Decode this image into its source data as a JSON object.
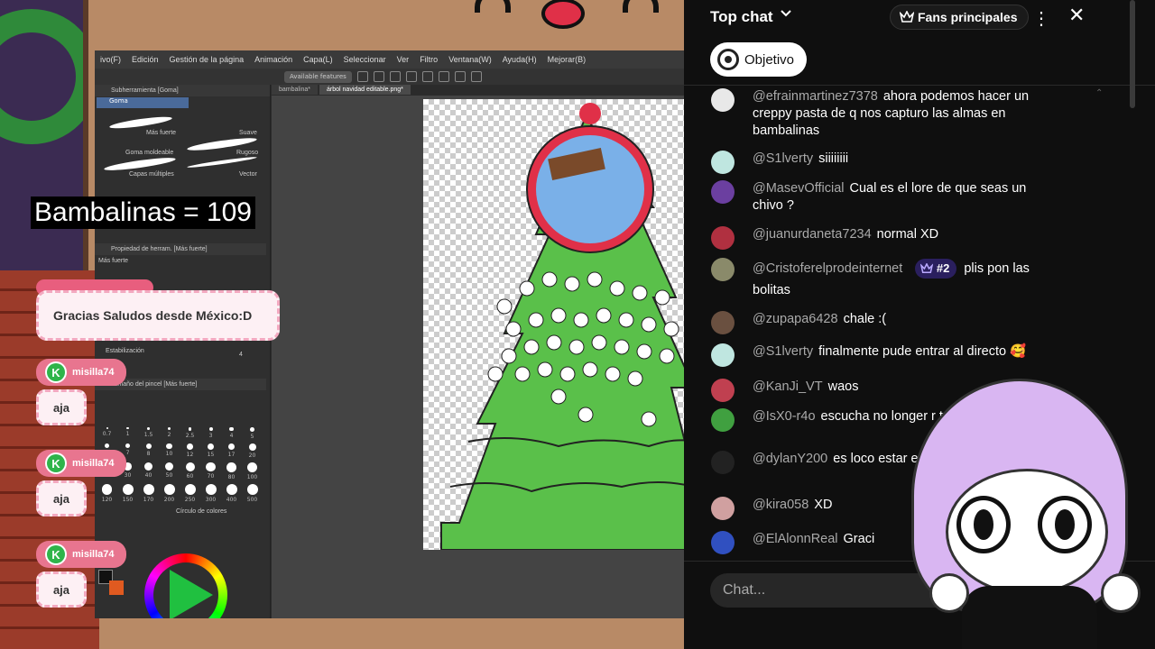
{
  "scene": {
    "counter": "Bambalinas = 109",
    "highlight_message": "Gracias Saludos desde México:D",
    "chat_messages": [
      {
        "user": "misilla74",
        "text": "aja"
      },
      {
        "user": "misilla74",
        "text": "aja"
      },
      {
        "user": "misilla74",
        "text": "aja"
      }
    ]
  },
  "csp": {
    "menu": [
      "ivo(F)",
      "Edición",
      "Gestión de la página",
      "Animación",
      "Capa(L)",
      "Seleccionar",
      "Ver",
      "Filtro",
      "Ventana(W)",
      "Ayuda(H)",
      "Mejorar(B)"
    ],
    "toolbar_pill": "Available features",
    "tabs": [
      "bambalina*",
      "árbol navidad editable.png*"
    ],
    "subtool_panel_title": "Subherramienta [Goma]",
    "subtool_selected": "Goma",
    "brushes": [
      "Más fuerte",
      "Suave",
      "Goma moldeable",
      "Rugoso",
      "Capas múltiples",
      "Vector"
    ],
    "tool_property_title": "Propiedad de herram. [Más fuerte]",
    "tool_property_item": "Más fuerte",
    "stabilization_label": "Estabilización",
    "stabilization_value": "4",
    "brush_size_title": "Tamaño del pincel [Más fuerte]",
    "brush_sizes": [
      "0.7",
      "1",
      "1.5",
      "2",
      "2.5",
      "3",
      "4",
      "5",
      "6",
      "7",
      "8",
      "10",
      "12",
      "15",
      "17",
      "20",
      "25",
      "30",
      "40",
      "50",
      "60",
      "70",
      "80",
      "100",
      "120",
      "150",
      "170",
      "200",
      "250",
      "300",
      "400",
      "500"
    ],
    "color_circle_label": "Círculo de colores"
  },
  "chat": {
    "title": "Top chat",
    "fans_button": "Fans principales",
    "objective_button": "Objetivo",
    "input_placeholder": "Chat...",
    "messages": [
      {
        "author": "@efrainmartinez7378",
        "text": "ahora podemos hacer un creppy pasta de q nos capturo las almas en bambalinas",
        "avatar_color": "#e8e8e8"
      },
      {
        "author": "@S1lverty",
        "text": "siiiiiiii",
        "avatar_color": "#bfe6e0"
      },
      {
        "author": "@MasevOfficial",
        "text": "Cual es el lore de que seas un chivo ?",
        "avatar_color": "#6b3fa0"
      },
      {
        "author": "@juanurdaneta7234",
        "text": "normal XD",
        "avatar_color": "#b03040"
      },
      {
        "author": "@Cristoferelprodeinternet",
        "badge": "#2",
        "text": "plis pon las bolitas",
        "avatar_color": "#8a8a6a"
      },
      {
        "author": "@zupapa6428",
        "text": "chale :(",
        "avatar_color": "#6a5040"
      },
      {
        "author": "@S1lverty",
        "text": "finalmente pude entrar al directo 🥰",
        "avatar_color": "#bfe6e0"
      },
      {
        "author": "@KanJi_VT",
        "text": "waos",
        "avatar_color": "#c04050"
      },
      {
        "author": "@IsX0-r4o",
        "text": "escucha no longer r te lo prometo xd",
        "avatar_color": "#40a040"
      },
      {
        "author": "@dylanY200",
        "text": "es loco estar e tiempo",
        "avatar_color": "#222222"
      },
      {
        "author": "@kira058",
        "text": "XD",
        "avatar_color": "#d0a0a0"
      },
      {
        "author": "@ElAlonnReal",
        "text": "Graci",
        "avatar_color": "#3050c0"
      }
    ]
  },
  "colors": {
    "chat_bg": "#0f0f0f",
    "badge_purple": "#2a1f5e",
    "pink_tag": "#e8758f",
    "k_green": "#2fb44a"
  }
}
